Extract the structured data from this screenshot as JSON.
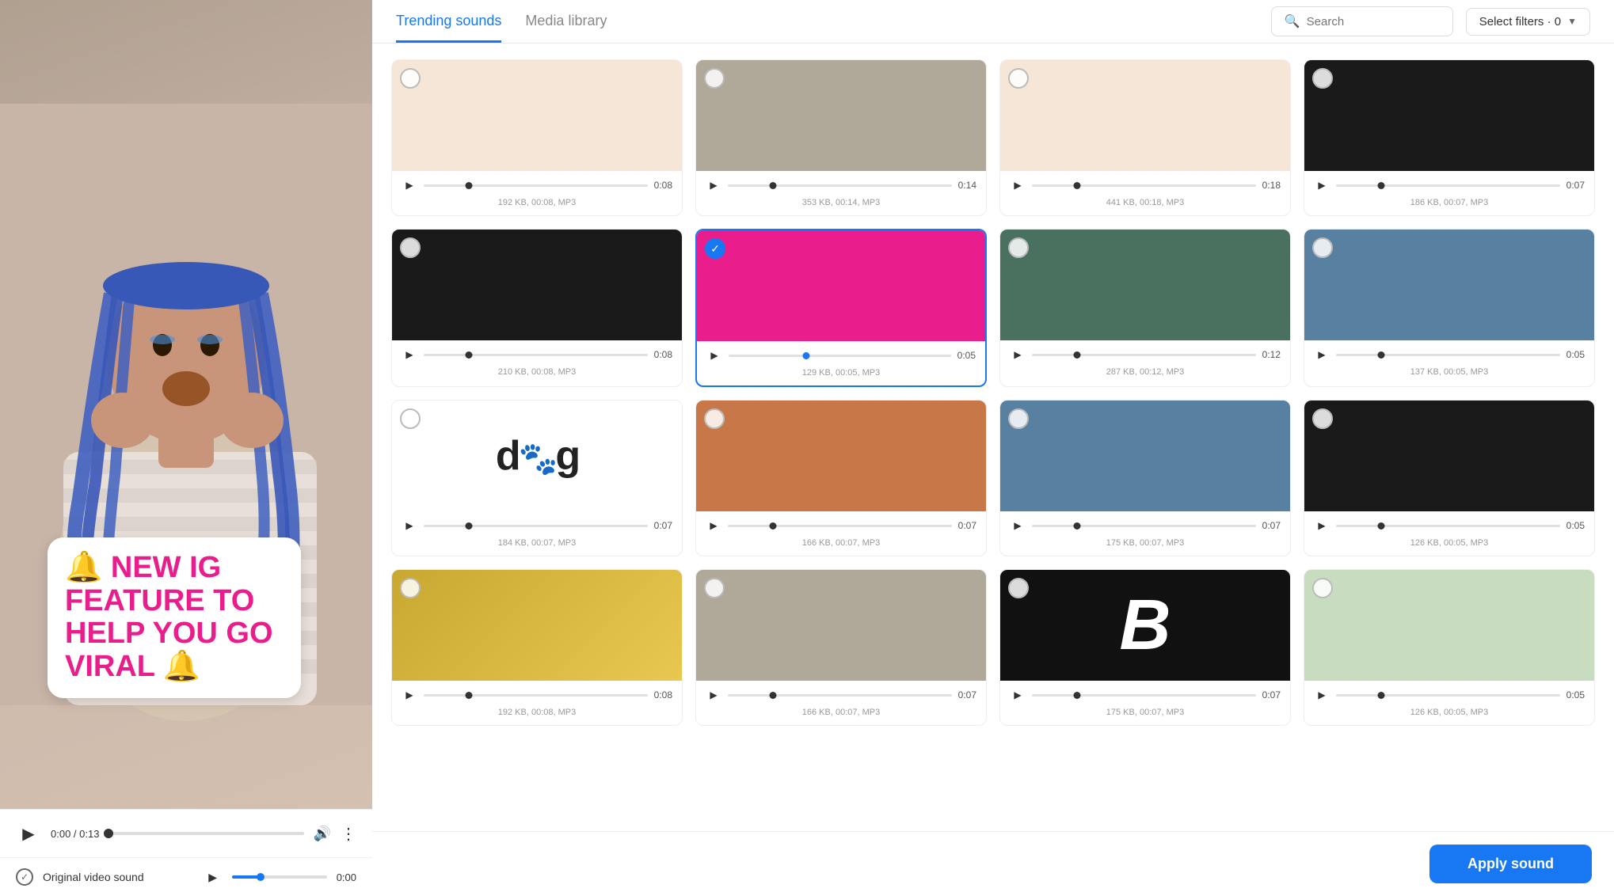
{
  "left": {
    "video_time": "0:00 / 0:13",
    "original_sound_label": "Original video sound",
    "original_time": "0:00",
    "text_overlay": "🔔 NEW IG FEATURE TO HELP YOU GO VIRAL 🔔"
  },
  "right": {
    "tabs": [
      {
        "id": "trending",
        "label": "Trending sounds",
        "active": true
      },
      {
        "id": "media",
        "label": "Media library",
        "active": false
      }
    ],
    "search": {
      "placeholder": "Search"
    },
    "filter_btn": "Select filters · 0",
    "apply_btn": "Apply sound",
    "sounds": [
      {
        "id": 1,
        "thumb_class": "thumb-light",
        "selected": false,
        "time": "0:08",
        "meta": "192 KB, 00:08, MP3"
      },
      {
        "id": 2,
        "thumb_class": "thumb-neutral",
        "selected": false,
        "time": "0:14",
        "meta": "353 KB, 00:14, MP3"
      },
      {
        "id": 3,
        "thumb_class": "thumb-light",
        "selected": false,
        "time": "0:18",
        "meta": "441 KB, 00:18, MP3"
      },
      {
        "id": 4,
        "thumb_class": "thumb-dark",
        "selected": false,
        "time": "0:07",
        "meta": "186 KB, 00:07, MP3"
      },
      {
        "id": 5,
        "thumb_class": "thumb-dark",
        "selected": false,
        "time": "0:08",
        "meta": "210 KB, 00:08, MP3"
      },
      {
        "id": 6,
        "thumb_class": "thumb-pink",
        "selected": true,
        "time": "0:05",
        "meta": "129 KB, 00:05, MP3"
      },
      {
        "id": 7,
        "thumb_class": "thumb-green",
        "selected": false,
        "time": "0:12",
        "meta": "287 KB, 00:12, MP3"
      },
      {
        "id": 8,
        "thumb_class": "thumb-cool",
        "selected": false,
        "time": "0:05",
        "meta": "137 KB, 00:05, MP3"
      },
      {
        "id": 9,
        "thumb_class": "thumb-dog",
        "selected": false,
        "time": "0:07",
        "meta": "184 KB, 00:07, MP3",
        "dog": true
      },
      {
        "id": 10,
        "thumb_class": "thumb-warm",
        "selected": false,
        "time": "0:07",
        "meta": "166 KB, 00:07, MP3"
      },
      {
        "id": 11,
        "thumb_class": "thumb-cool",
        "selected": false,
        "time": "0:07",
        "meta": "175 KB, 00:07, MP3"
      },
      {
        "id": 12,
        "thumb_class": "thumb-dark",
        "selected": false,
        "time": "0:05",
        "meta": "126 KB, 00:05, MP3"
      },
      {
        "id": 13,
        "thumb_class": "thumb-gold",
        "selected": false,
        "time": "0:08",
        "meta": "192 KB, 00:08, MP3"
      },
      {
        "id": 14,
        "thumb_class": "thumb-neutral",
        "selected": false,
        "time": "0:07",
        "meta": "166 KB, 00:07, MP3"
      },
      {
        "id": 15,
        "thumb_class": "thumb-text-b",
        "selected": false,
        "time": "0:07",
        "meta": "175 KB, 00:07, MP3",
        "btext": true
      },
      {
        "id": 16,
        "thumb_class": "thumb-floral",
        "selected": false,
        "time": "0:05",
        "meta": "126 KB, 00:05, MP3"
      }
    ]
  }
}
